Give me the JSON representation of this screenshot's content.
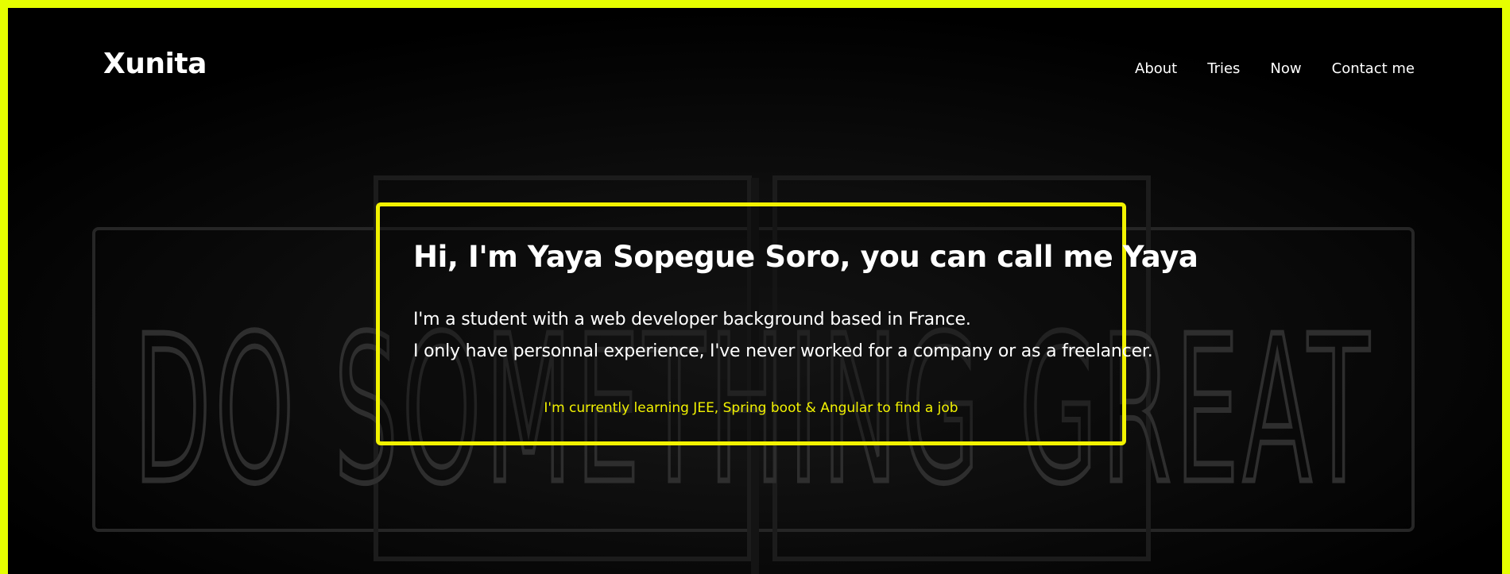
{
  "brand": {
    "name": "Xunita"
  },
  "nav": {
    "items": [
      {
        "label": "About"
      },
      {
        "label": "Tries"
      },
      {
        "label": "Now"
      },
      {
        "label": "Contact me"
      }
    ]
  },
  "hero": {
    "title": "Hi, I'm Yaya Sopegue Soro, you can call me Yaya",
    "line1": "I'm a student with a web developer background based in France.",
    "line2": "I only have personnal experience, I've never worked for a company or as a freelancer.",
    "note": "I'm currently learning JEE, Spring boot & Angular to find a job"
  },
  "background": {
    "sign_text": "DO SOMETHING GREAT"
  },
  "colors": {
    "accent": "#f2f200",
    "border_frame": "#e6ff00",
    "background": "#000000",
    "text": "#ffffff"
  }
}
